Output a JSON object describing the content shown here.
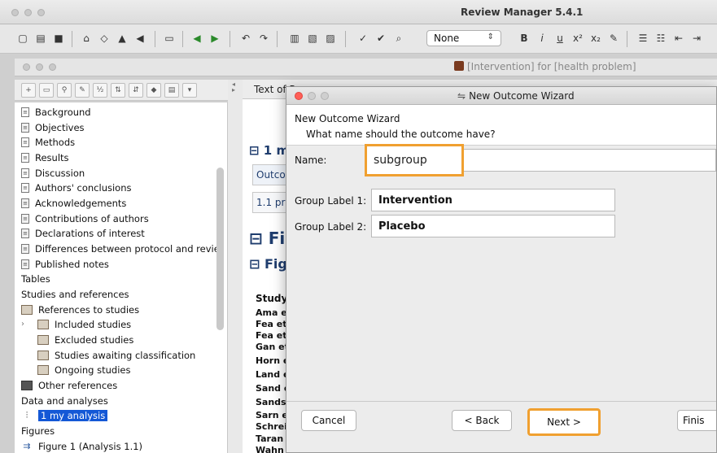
{
  "app": {
    "title": "Review Manager 5.4.1"
  },
  "toolbar": {
    "style_select": "None",
    "format_buttons": [
      "B",
      "i",
      "u",
      "x²",
      "x₂"
    ]
  },
  "document": {
    "title": "[Intervention] for [health problem]"
  },
  "outline": {
    "items": [
      {
        "label": "Background"
      },
      {
        "label": "Objectives"
      },
      {
        "label": "Methods"
      },
      {
        "label": "Results"
      },
      {
        "label": "Discussion"
      },
      {
        "label": "Authors' conclusions"
      },
      {
        "label": "Acknowledgements"
      },
      {
        "label": "Contributions of authors"
      },
      {
        "label": "Declarations of interest"
      },
      {
        "label": "Differences between protocol and revie"
      },
      {
        "label": "Published notes"
      },
      {
        "label": "Tables"
      },
      {
        "label": "Studies and references"
      },
      {
        "label": "References to studies"
      },
      {
        "label": "Included studies"
      },
      {
        "label": "Excluded studies"
      },
      {
        "label": "Studies awaiting classification"
      },
      {
        "label": "Ongoing studies"
      },
      {
        "label": "Other references"
      },
      {
        "label": "Data and analyses"
      },
      {
        "label": "1 my analysis"
      },
      {
        "label": "Figures"
      },
      {
        "label": "Figure 1 (Analysis 1.1)"
      }
    ]
  },
  "content": {
    "tab_label": "Text of R",
    "heading_1": "1 m",
    "box_1": "Outco",
    "box_2": "1.1 pr",
    "fig_heading_1": "Fig",
    "fig_heading_2": "Figu",
    "study_header": "Study",
    "studies": [
      "Ama et",
      "Fea et.",
      "Fea et.",
      "Gan et",
      "Horn e",
      "Land e",
      "Sand e",
      "Sands",
      "Sarn et",
      "Schreib",
      "Taran",
      "Wahn"
    ]
  },
  "dialog": {
    "title": "New Outcome Wizard",
    "header_title": "New Outcome Wizard",
    "header_question": "What name should the outcome have?",
    "name_label": "Name:",
    "name_value": "subgroup",
    "group1_label": "Group Label 1:",
    "group1_value": "Intervention",
    "group2_label": "Group Label 2:",
    "group2_value": "Placebo",
    "buttons": {
      "cancel": "Cancel",
      "back": "< Back",
      "next": "Next >",
      "finish": "Finis"
    }
  }
}
